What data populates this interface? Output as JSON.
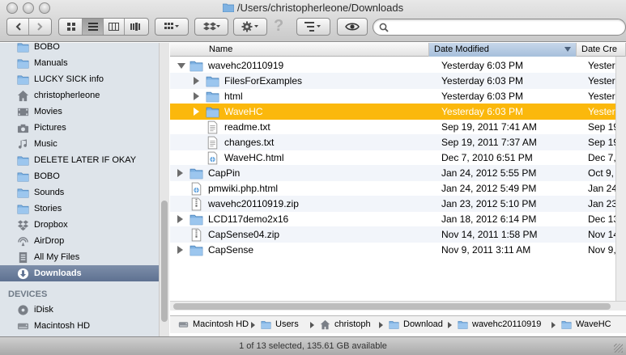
{
  "window": {
    "title": "/Users/christopherleone/Downloads"
  },
  "toolbar": {
    "back_icon": "chevron-left-icon",
    "forward_icon": "chevron-right-icon",
    "views": [
      "icon-view",
      "list-view",
      "column-view",
      "coverflow-view"
    ],
    "active_view": "list-view",
    "search_placeholder": ""
  },
  "sidebar": {
    "items": [
      {
        "label": "BOBO",
        "icon": "folder-icon"
      },
      {
        "label": "Manuals",
        "icon": "folder-icon"
      },
      {
        "label": "LUCKY SICK info",
        "icon": "folder-icon"
      },
      {
        "label": "christopherleone",
        "icon": "home-icon"
      },
      {
        "label": "Movies",
        "icon": "film-icon"
      },
      {
        "label": "Pictures",
        "icon": "camera-icon"
      },
      {
        "label": "Music",
        "icon": "music-icon"
      },
      {
        "label": "DELETE LATER IF OKAY",
        "icon": "folder-icon"
      },
      {
        "label": "BOBO",
        "icon": "folder-icon"
      },
      {
        "label": "Sounds",
        "icon": "folder-icon"
      },
      {
        "label": "Stories",
        "icon": "folder-icon"
      },
      {
        "label": "Dropbox",
        "icon": "dropbox-icon"
      },
      {
        "label": "AirDrop",
        "icon": "airdrop-icon"
      },
      {
        "label": "All My Files",
        "icon": "files-icon"
      },
      {
        "label": "Downloads",
        "icon": "download-icon",
        "selected": true
      }
    ],
    "devices_heading": "DEVICES",
    "devices": [
      {
        "label": "iDisk",
        "icon": "disk-icon"
      },
      {
        "label": "Macintosh HD",
        "icon": "drive-icon"
      }
    ]
  },
  "list": {
    "columns": {
      "name": "Name",
      "date_modified": "Date Modified",
      "date_created": "Date Cre"
    },
    "rows": [
      {
        "name": "wavehc20110919",
        "date": "Yesterday 6:03 PM",
        "date2": "Yesterda",
        "kind": "folder",
        "disclosure": "open",
        "level": 0
      },
      {
        "name": "FilesForExamples",
        "date": "Yesterday 6:03 PM",
        "date2": "Yesterda",
        "kind": "folder",
        "disclosure": "closed",
        "level": 1
      },
      {
        "name": "html",
        "date": "Yesterday 6:03 PM",
        "date2": "Yesterda",
        "kind": "folder",
        "disclosure": "closed",
        "level": 1
      },
      {
        "name": "WaveHC",
        "date": "Yesterday 6:03 PM",
        "date2": "Yesterda",
        "kind": "folder",
        "disclosure": "closed",
        "level": 1,
        "selected": true
      },
      {
        "name": "readme.txt",
        "date": "Sep 19, 2011 7:41 AM",
        "date2": "Sep 19,",
        "kind": "text",
        "disclosure": "none",
        "level": 1
      },
      {
        "name": "changes.txt",
        "date": "Sep 19, 2011 7:37 AM",
        "date2": "Sep 19,",
        "kind": "text",
        "disclosure": "none",
        "level": 1
      },
      {
        "name": "WaveHC.html",
        "date": "Dec 7, 2010 6:51 PM",
        "date2": "Dec 7,",
        "kind": "html",
        "disclosure": "none",
        "level": 1
      },
      {
        "name": "CapPin",
        "date": "Jan 24, 2012 5:55 PM",
        "date2": "Oct 9, 2",
        "kind": "folder",
        "disclosure": "closed",
        "level": 0
      },
      {
        "name": "pmwiki.php.html",
        "date": "Jan 24, 2012 5:49 PM",
        "date2": "Jan 24,",
        "kind": "html",
        "disclosure": "none",
        "level": 0
      },
      {
        "name": "wavehc20110919.zip",
        "date": "Jan 23, 2012 5:10 PM",
        "date2": "Jan 23,",
        "kind": "zip",
        "disclosure": "none",
        "level": 0
      },
      {
        "name": "LCD117demo2x16",
        "date": "Jan 18, 2012 6:14 PM",
        "date2": "Dec 13,",
        "kind": "folder",
        "disclosure": "closed",
        "level": 0
      },
      {
        "name": "CapSense04.zip",
        "date": "Nov 14, 2011 1:58 PM",
        "date2": "Nov 14,",
        "kind": "zip",
        "disclosure": "none",
        "level": 0
      },
      {
        "name": "CapSense",
        "date": "Nov 9, 2011 3:11 AM",
        "date2": "Nov 9, 2",
        "kind": "folder",
        "disclosure": "closed",
        "level": 0
      }
    ]
  },
  "pathbar": {
    "crumbs": [
      {
        "label": "Macintosh HD",
        "icon": "drive-icon"
      },
      {
        "label": "Users",
        "icon": "folder-icon"
      },
      {
        "label": "christoph",
        "icon": "home-icon"
      },
      {
        "label": "Download",
        "icon": "folder-icon"
      },
      {
        "label": "wavehc20110919",
        "icon": "folder-icon"
      },
      {
        "label": "WaveHC",
        "icon": "folder-icon"
      }
    ]
  },
  "status": {
    "text": "1 of 13 selected, 135.61 GB available"
  },
  "colors": {
    "selection": "#fbb80c",
    "sidebar": "#dee4ea",
    "sidebar_selected": "#5e7191",
    "folder": "#6aa8e0"
  }
}
